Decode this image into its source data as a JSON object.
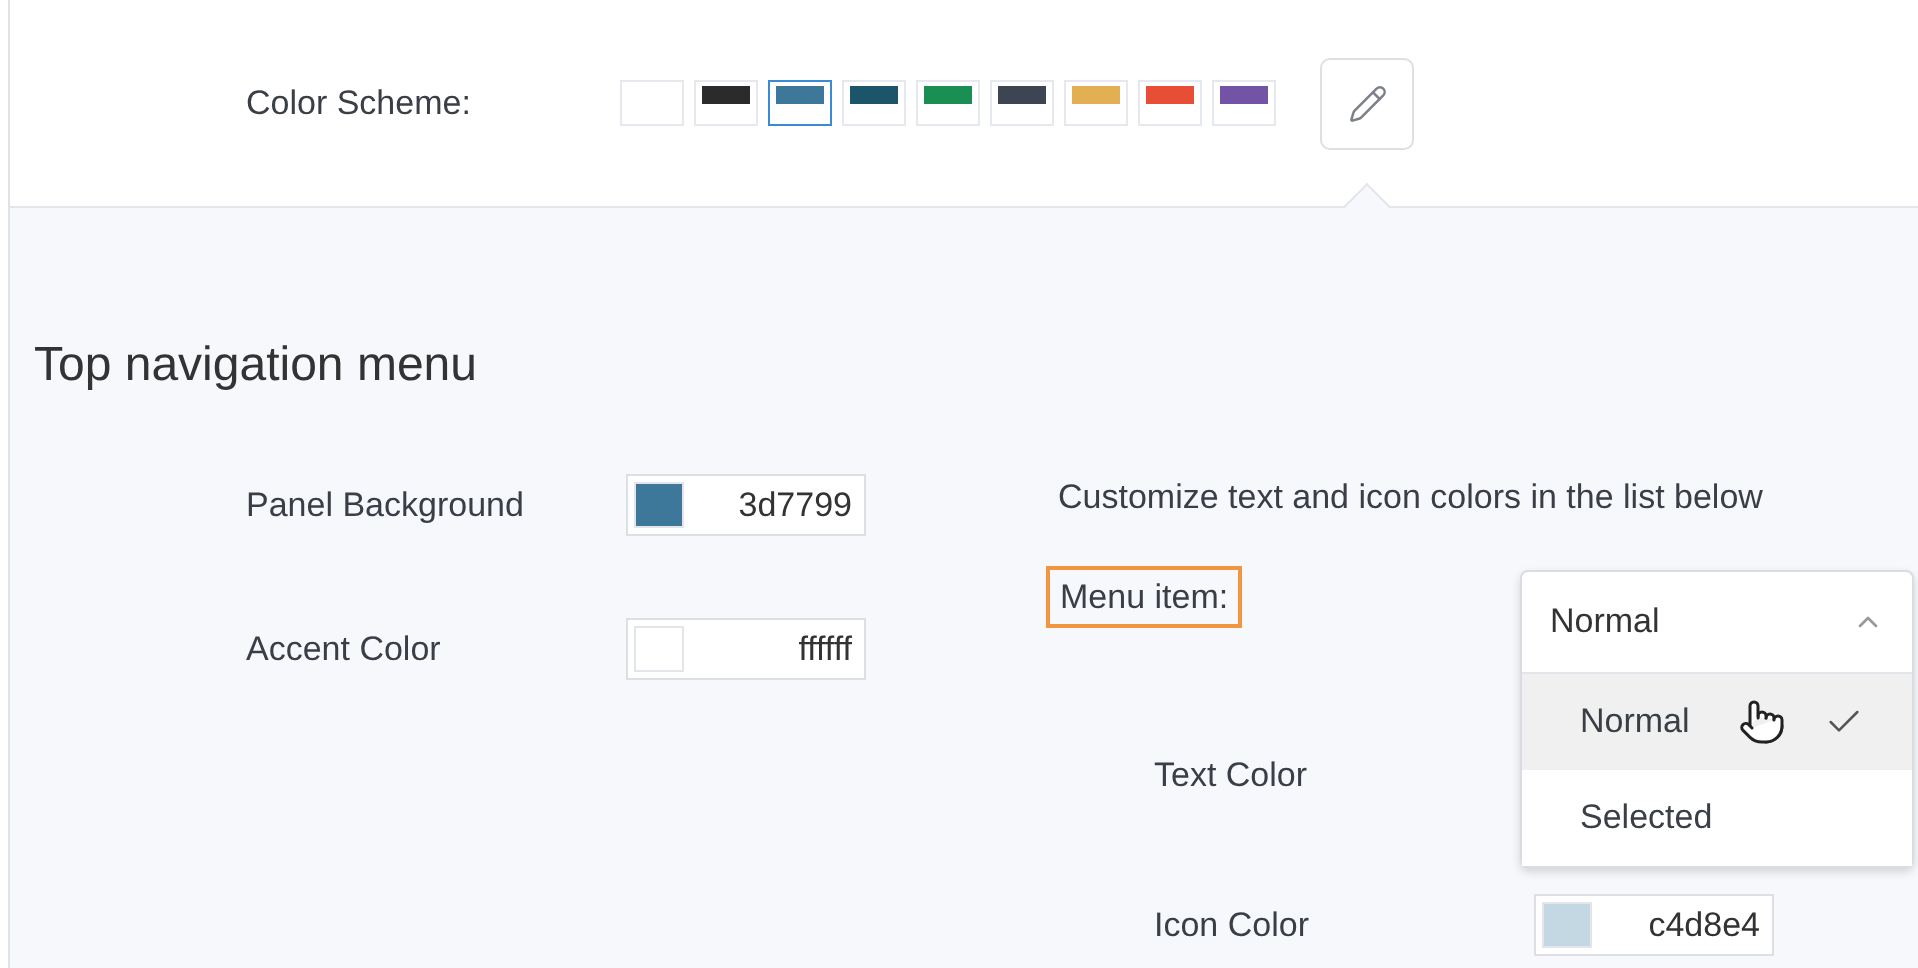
{
  "color_scheme": {
    "label": "Color Scheme:",
    "swatches": [
      {
        "color": "#ffffff",
        "selected": false
      },
      {
        "color": "#2b2b2b",
        "selected": false
      },
      {
        "color": "#3d7799",
        "selected": true
      },
      {
        "color": "#1c5469",
        "selected": false
      },
      {
        "color": "#1a8f53",
        "selected": false
      },
      {
        "color": "#3c4551",
        "selected": false
      },
      {
        "color": "#e2b053",
        "selected": false
      },
      {
        "color": "#e84e36",
        "selected": false
      },
      {
        "color": "#7353a5",
        "selected": false
      }
    ]
  },
  "section": {
    "title": "Top navigation menu"
  },
  "colors": [
    {
      "label": "Panel Background",
      "value": "3d7799",
      "color": "#3d7799"
    },
    {
      "label": "Accent Color",
      "value": "ffffff",
      "color": "#ffffff"
    }
  ],
  "description": "Customize text and icon colors in the list below",
  "menu_item": {
    "label": "Menu item:",
    "dropdown": {
      "value": "Normal",
      "expanded": true,
      "options": [
        {
          "label": "Normal",
          "selected": true
        },
        {
          "label": "Selected",
          "selected": false
        }
      ]
    }
  },
  "item_colors": [
    {
      "label": "Text Color"
    },
    {
      "label": "Icon Color",
      "value": "c4d8e4",
      "color": "#c4d8e4"
    }
  ]
}
